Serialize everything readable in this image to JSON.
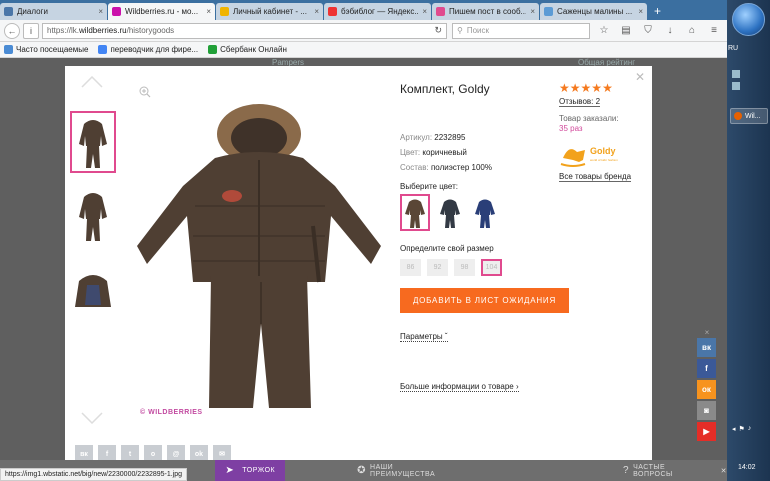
{
  "browser": {
    "tabs": [
      {
        "title": "Диалоги",
        "color": "#4a76a8",
        "active": false
      },
      {
        "title": "Wildberries.ru - мо...",
        "color": "#cb11ab",
        "active": true
      },
      {
        "title": "Личный кабинет - ...",
        "color": "#f0b400",
        "active": false
      },
      {
        "title": "бэбиблог — Яндекс...",
        "color": "#e33",
        "active": false
      },
      {
        "title": "Пишем пост в сооб...",
        "color": "#e04a8e",
        "active": false
      },
      {
        "title": "Саженцы малины ...",
        "color": "#5b9bd5",
        "active": false
      }
    ],
    "new_tab_symbol": "+",
    "url_prefix": "https://lk.",
    "url_host": "wildberries.ru",
    "url_path": "/historygoods",
    "search_placeholder": "Поиск",
    "bookmarks": [
      {
        "label": "Часто посещаемые",
        "color": "#4a8bd4"
      },
      {
        "label": "переводчик для фире...",
        "color": "#4285f4"
      },
      {
        "label": "Сбербанк Онлайн",
        "color": "#21a038"
      }
    ]
  },
  "background": {
    "text_left": "Pampers",
    "text_right": "Общая рейтинг"
  },
  "product": {
    "title": "Комплект, Goldy",
    "article_label": "Артикул:",
    "article_value": "2232895",
    "color_label": "Цвет:",
    "color_value": "коричневый",
    "composition_label": "Состав:",
    "composition_value": "полиэстер 100%",
    "choose_color_label": "Выберите цвет:",
    "swatches": [
      {
        "color": "#5a4636",
        "selected": true
      },
      {
        "color": "#333a44",
        "selected": false
      },
      {
        "color": "#2a3f78",
        "selected": false
      }
    ],
    "size_label": "Определите свой размер",
    "sizes": [
      {
        "label": "86",
        "selected": false
      },
      {
        "label": "92",
        "selected": false
      },
      {
        "label": "98",
        "selected": false
      },
      {
        "label": "104",
        "selected": true
      }
    ],
    "wishlist_button": "ДОБАВИТЬ В ЛИСТ ОЖИДАНИЯ",
    "params_link": "Параметры",
    "more_info_link": "Больше информации о товаре",
    "watermark": "© WILDBERRIES",
    "rating_stars": 5,
    "reviews_label": "Отзывов: 2",
    "ordered_label": "Товар заказали:",
    "ordered_value": "35 раз",
    "brand_name": "Goldy",
    "brand_tagline": "world of kids' fashion",
    "all_brand_link": "Все товары бренда",
    "main_color": "#4f3f33",
    "accent_color": "#e04a8e",
    "button_color": "#f76a1f"
  },
  "share_buttons": [
    "vk",
    "fb",
    "tw",
    "ok",
    "@",
    "ok",
    "mail"
  ],
  "share_labels": [
    "вк",
    "f",
    "t",
    "o",
    "@",
    "ok",
    "✉"
  ],
  "social_sidebar": [
    {
      "name": "vk",
      "label": "вк",
      "color": "#4a76a8"
    },
    {
      "name": "facebook",
      "label": "f",
      "color": "#3b5998"
    },
    {
      "name": "odnoklassniki",
      "label": "ок",
      "color": "#f7931e"
    },
    {
      "name": "instagram",
      "label": "◙",
      "color": "#8a8a8a"
    },
    {
      "name": "youtube",
      "label": "▶",
      "color": "#e52d27"
    }
  ],
  "bottombar": {
    "item1": "ТОРЖОК",
    "item2": "НАШИ ПРЕИМУЩЕСТВА",
    "item3": "ЧАСТЫЕ ВОПРОСЫ"
  },
  "status_url": "https://img1.wbstatic.net/big/new/2230000/2232895-1.jpg",
  "taskbar": {
    "lang": "RU",
    "task_label": "Wil...",
    "clock": "14:02"
  }
}
